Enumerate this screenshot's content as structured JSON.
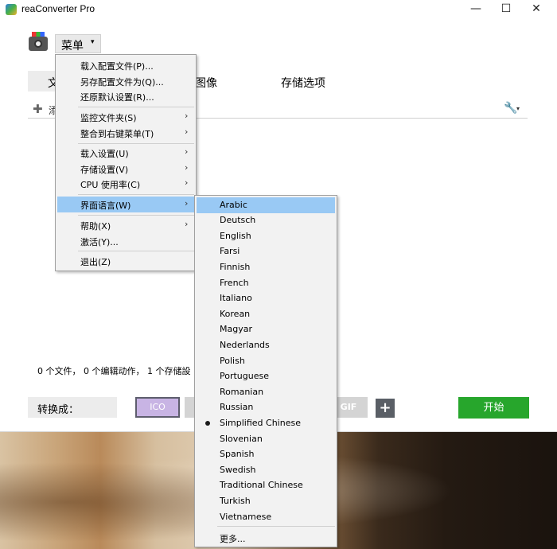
{
  "window": {
    "title": "reaConverter Pro",
    "minimize_glyph": "—",
    "maximize_glyph": "☐",
    "close_glyph": "✕"
  },
  "menu_button": {
    "label": "菜单",
    "arrow": "▾"
  },
  "tabs": [
    {
      "label": "文"
    },
    {
      "label": "图像"
    },
    {
      "label": "存储选项"
    }
  ],
  "toolbar": {
    "add_icon": "plus-icon",
    "add_glyph": "✚",
    "add_label": "添",
    "settings_glyph": "🔧",
    "settings_arrow": "▾"
  },
  "status": {
    "text": "0 个文件， 0 个编辑动作， 1 个存储設"
  },
  "convert": {
    "label": "转换成：",
    "formats": [
      "ICO",
      "GIF"
    ],
    "add_format_glyph": "+",
    "start_label": "开始"
  },
  "main_menu": {
    "items": [
      {
        "label": "载入配置文件(P)...",
        "submenu": false
      },
      {
        "label": "另存配置文件为(Q)...",
        "submenu": false
      },
      {
        "label": "还原默认设置(R)...",
        "submenu": false
      },
      {
        "label": "监控文件夹(S)",
        "submenu": true
      },
      {
        "label": "整合到右键菜单(T)",
        "submenu": true
      },
      {
        "label": "载入设置(U)",
        "submenu": true
      },
      {
        "label": "存储设置(V)",
        "submenu": true
      },
      {
        "label": "CPU 使用率(C)",
        "submenu": true
      },
      {
        "label": "界面语言(W)",
        "submenu": true,
        "highlighted": true
      },
      {
        "label": "帮助(X)",
        "submenu": true
      },
      {
        "label": "激活(Y)...",
        "submenu": false
      },
      {
        "label": "退出(Z)",
        "submenu": false
      }
    ],
    "arrow_glyph": "›"
  },
  "language_menu": {
    "items": [
      {
        "label": "Arabic",
        "highlighted": true
      },
      {
        "label": "Deutsch"
      },
      {
        "label": "English"
      },
      {
        "label": "Farsi"
      },
      {
        "label": "Finnish"
      },
      {
        "label": "French"
      },
      {
        "label": "Italiano"
      },
      {
        "label": "Korean"
      },
      {
        "label": "Magyar"
      },
      {
        "label": "Nederlands"
      },
      {
        "label": "Polish"
      },
      {
        "label": "Portuguese"
      },
      {
        "label": "Romanian"
      },
      {
        "label": "Russian"
      },
      {
        "label": "Simplified Chinese",
        "selected": true
      },
      {
        "label": "Slovenian"
      },
      {
        "label": "Spanish"
      },
      {
        "label": "Swedish"
      },
      {
        "label": "Traditional Chinese"
      },
      {
        "label": "Turkish"
      },
      {
        "label": "Vietnamese"
      }
    ],
    "more_label": "更多..."
  },
  "colors": {
    "highlight": "#99c9f4",
    "start_green": "#27a62c",
    "ico_purple": "#c8b4e4"
  }
}
